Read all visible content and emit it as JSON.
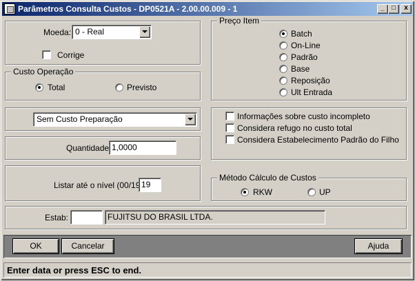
{
  "window": {
    "title": "Parâmetros Consulta Custos - DP0521A - 2.00.00.009 - 1",
    "minimize": "_",
    "maximize": "□",
    "close": "x"
  },
  "moeda": {
    "label": "Moeda:",
    "value": "0 - Real"
  },
  "corrige": {
    "label": "Corrige",
    "checked": false
  },
  "custo_operacao": {
    "legend": "Custo Operação",
    "options": [
      {
        "label": "Total",
        "selected": true
      },
      {
        "label": "Previsto",
        "selected": false
      }
    ]
  },
  "preparacao": {
    "value": "Sem Custo Preparação"
  },
  "quantidade": {
    "label": "Quantidade:",
    "value": "1,0000"
  },
  "nivel": {
    "label": "Listar até o nível (00/19):",
    "value": "19"
  },
  "preco_item": {
    "legend": "Preço Item",
    "options": [
      {
        "label": "Batch",
        "selected": true
      },
      {
        "label": "On-Line",
        "selected": false
      },
      {
        "label": "Padrão",
        "selected": false
      },
      {
        "label": "Base",
        "selected": false
      },
      {
        "label": "Reposição",
        "selected": false
      },
      {
        "label": "Ult Entrada",
        "selected": false
      }
    ]
  },
  "flags": [
    {
      "label": "Informações sobre custo incompleto",
      "checked": false
    },
    {
      "label": "Considera refugo no custo total",
      "checked": false
    },
    {
      "label": "Considera Estabelecimento Padrão do Filho",
      "checked": false
    }
  ],
  "metodo": {
    "legend": "Método Cálculo de Custos",
    "options": [
      {
        "label": "RKW",
        "selected": true
      },
      {
        "label": "UP",
        "selected": false
      }
    ]
  },
  "estab": {
    "label": "Estab:",
    "code": "",
    "name": "FUJITSU DO BRASIL LTDA."
  },
  "buttons": {
    "ok": "OK",
    "cancelar": "Cancelar",
    "ajuda": "Ajuda"
  },
  "status": "Enter data or press ESC to end."
}
